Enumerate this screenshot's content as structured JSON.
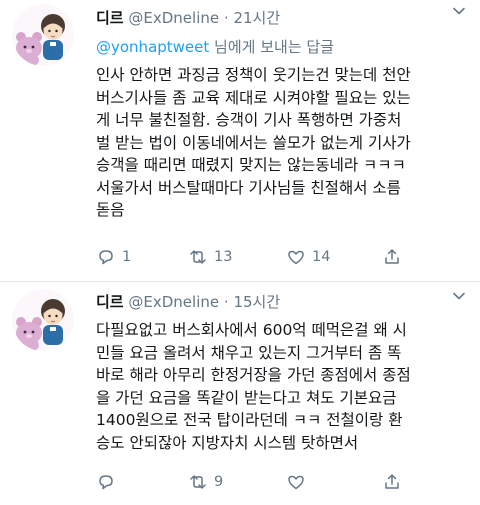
{
  "tweets": [
    {
      "name": "디르",
      "handle": "@ExDneline",
      "dot": "·",
      "time": "21시간",
      "reply_to": {
        "mention": "@yonhaptweet",
        "suffix": " 님에게 보내는 답글"
      },
      "lines": [
        "인사 안하면 과징금 정책이 웃기는건 맞는데 천안",
        "버스기사들 좀 교육 제대로 시켜야할 필요는 있는",
        "게 너무 불친절함. 승객이 기사 폭행하면 가중처",
        "벌 받는 법이 이동네에서는 쓸모가 없는게 기사가",
        "승객을 때리면 때렸지 맞지는 않는동네라 ㅋㅋㅋ",
        "서울가서 버스탈때마다 기사님들 친절해서 소름",
        "돋음"
      ],
      "actions": {
        "reply_count": "1",
        "retweet_count": "13",
        "like_count": "14"
      }
    },
    {
      "name": "디르",
      "handle": "@ExDneline",
      "dot": "·",
      "time": "15시간",
      "lines": [
        "다필요없고 버스회사에서 600억 떼먹은걸 왜 시",
        "민들 요금 올려서 채우고 있는지 그거부터 좀 똑",
        "바로 해라 아무리 한정거장을 가던 종점에서 종점",
        "을 가던 요금을 똑같이 받는다고 쳐도 기본요금",
        "1400원으로 전국 탑이라던데 ㅋㅋ 전철이랑 환",
        "승도 안되잖아 지방자치 시스템 탓하면서"
      ],
      "actions": {
        "reply_count": "",
        "retweet_count": "9",
        "like_count": ""
      }
    }
  ],
  "icons": {
    "reply": "reply-icon",
    "retweet": "retweet-icon",
    "like": "heart-icon",
    "share": "share-icon",
    "more": "chevron-down-icon"
  },
  "colors": {
    "text": "#14171a",
    "muted": "#657786",
    "link": "#1da1f2",
    "divider": "#e1e8ed"
  }
}
